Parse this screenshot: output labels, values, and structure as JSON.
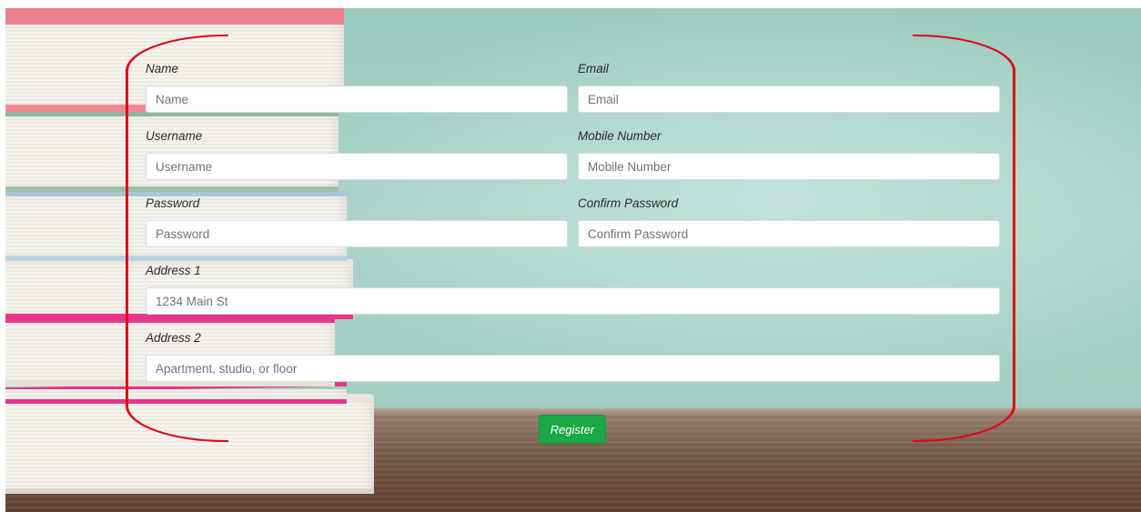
{
  "form": {
    "fields": {
      "name": {
        "label": "Name",
        "placeholder": "Name"
      },
      "email": {
        "label": "Email",
        "placeholder": "Email"
      },
      "username": {
        "label": "Username",
        "placeholder": "Username"
      },
      "mobile": {
        "label": "Mobile Number",
        "placeholder": "Mobile Number"
      },
      "password": {
        "label": "Password",
        "placeholder": "Password"
      },
      "confirm_password": {
        "label": "Confirm Password",
        "placeholder": "Confirm Password"
      },
      "address1": {
        "label": "Address 1",
        "placeholder": "1234 Main St"
      },
      "address2": {
        "label": "Address 2",
        "placeholder": "Apartment, studio, or floor"
      }
    },
    "submit_label": "Register"
  },
  "colors": {
    "bracket": "#e00514",
    "button": "#1aa746",
    "wall": "#a7d2c7",
    "table": "#6b4c3b"
  }
}
